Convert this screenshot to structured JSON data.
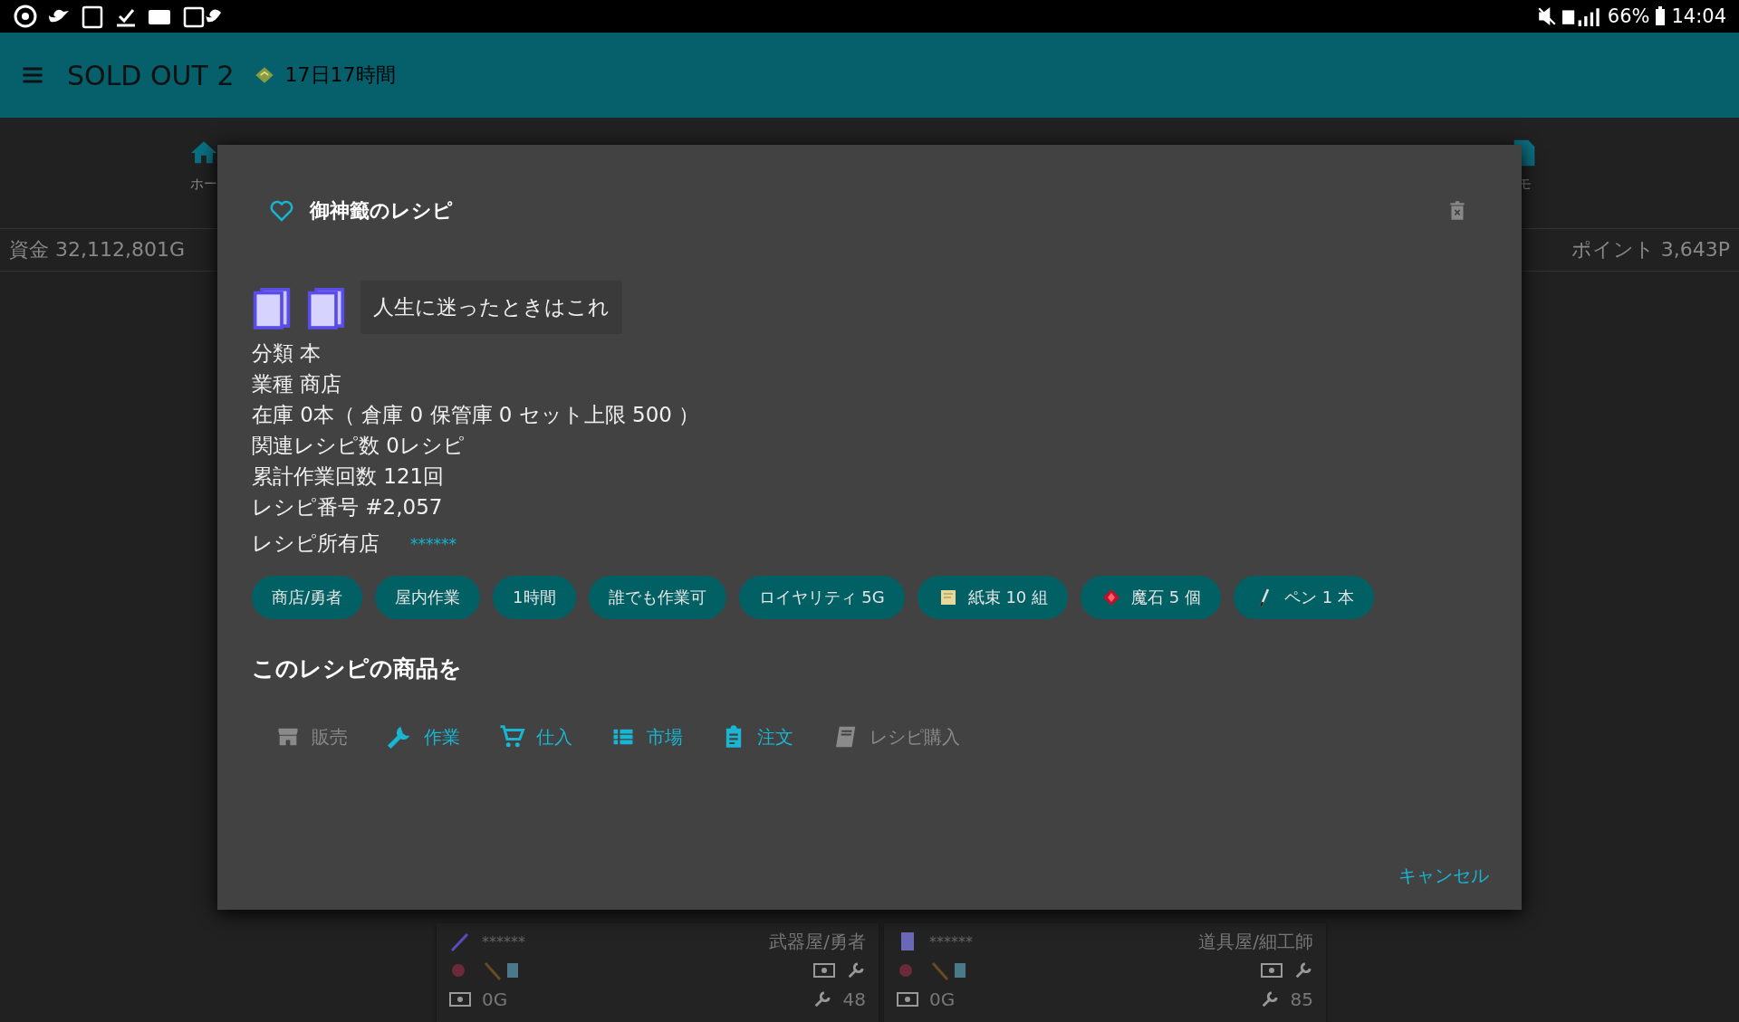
{
  "status_bar": {
    "battery": "66%",
    "time": "14:04"
  },
  "app_bar": {
    "title": "SOLD OUT 2",
    "timer": "17日17時間"
  },
  "nav": [
    {
      "label": "ホー",
      "kind": "home"
    },
    {
      "label": "モ",
      "kind": "memo"
    }
  ],
  "balance": {
    "funds": "資金 32,112,801G",
    "points": "ポイント 3,643P"
  },
  "shop_cards": [
    {
      "stars": "******",
      "category": "武器屋/勇者",
      "money": "0G",
      "work": "48",
      "kind": "staff"
    },
    {
      "stars": "******",
      "category": "道具屋/細工師",
      "money": "0G",
      "work": "85",
      "kind": "book"
    }
  ],
  "dialog": {
    "title": "御神籤のレシピ",
    "favorite": false,
    "item_icons": [
      {
        "kind": "book"
      },
      {
        "kind": "book"
      }
    ],
    "description": "人生に迷ったときはこれ",
    "details": [
      "分類 本",
      "業種 商店",
      "在庫 0本（ 倉庫 0  保管庫 0  セット上限 500 ）",
      "関連レシピ数 0レシピ",
      "累計作業回数 121回",
      "レシピ番号 #2,057"
    ],
    "owner_label": "レシピ所有店",
    "owner": "******",
    "tags": [
      {
        "label": "商店/勇者",
        "kind": "plain"
      },
      {
        "label": "屋内作業",
        "kind": "plain"
      },
      {
        "label": "1時間",
        "kind": "plain"
      },
      {
        "label": "誰でも作業可",
        "kind": "plain"
      },
      {
        "label": "ロイヤリティ 5G",
        "kind": "plain"
      },
      {
        "label": "紙束 10 組",
        "kind": "paper"
      },
      {
        "label": "魔石 5 個",
        "kind": "gem"
      },
      {
        "label": "ペン 1 本",
        "kind": "pen"
      }
    ],
    "section_heading": "このレシピの商品を",
    "actions": [
      {
        "label": "販売",
        "kind": "store",
        "disabled": true
      },
      {
        "label": "作業",
        "kind": "wrench",
        "disabled": false
      },
      {
        "label": "仕入",
        "kind": "cart",
        "disabled": false
      },
      {
        "label": "市場",
        "kind": "list",
        "disabled": false
      },
      {
        "label": "注文",
        "kind": "clipboard",
        "disabled": false
      },
      {
        "label": "レシピ購入",
        "kind": "book",
        "disabled": true
      }
    ],
    "cancel": "キャンセル"
  }
}
